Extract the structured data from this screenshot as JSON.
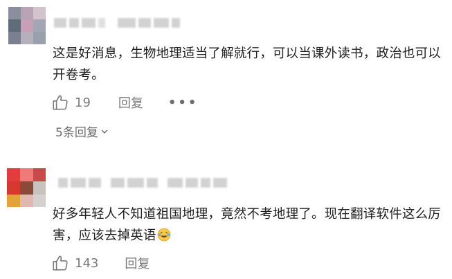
{
  "comments": [
    {
      "text": "这是好消息，生物地理适当了解就行，可以当课外读书，政治也可以开卷考。",
      "likes": "19",
      "reply_label": "回复",
      "more_label": "•••",
      "replies_label": "5条回复"
    },
    {
      "text": "好多年轻人不知道祖国地理，竟然不考地理了。现在翻译软件这么厉害，应该去掉英语",
      "likes": "143",
      "reply_label": "回复"
    }
  ],
  "icons": {
    "like": "thumbs-up-icon",
    "more": "more-dots-icon",
    "expand": "chevron-down-icon",
    "emoji": "laughing-crying-emoji"
  },
  "colors": {
    "text": "#1f1f1f",
    "muted": "#7a7a7a",
    "background": "#ffffff"
  }
}
